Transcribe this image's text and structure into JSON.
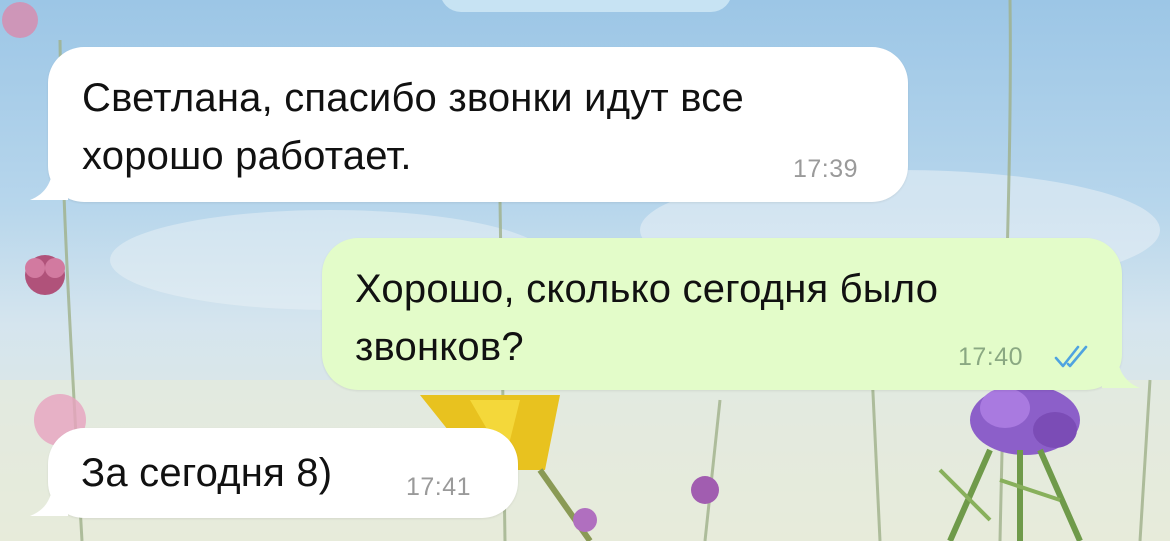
{
  "messages": [
    {
      "direction": "incoming",
      "text": "Светлана, спасибо звонки идут все\nхорошо работает.",
      "time": "17:39"
    },
    {
      "direction": "outgoing",
      "text": "Хорошо, сколько сегодня было\nзвонков?",
      "time": "17:40",
      "status_icon": "double-check-icon"
    },
    {
      "direction": "incoming",
      "text": "За сегодня 8)",
      "time": "17:41"
    }
  ],
  "colors": {
    "incoming_bubble": "#ffffff",
    "outgoing_bubble": "#e3fcc9",
    "read_check": "#4fa3e0",
    "timestamp": "#9a9a9a"
  }
}
